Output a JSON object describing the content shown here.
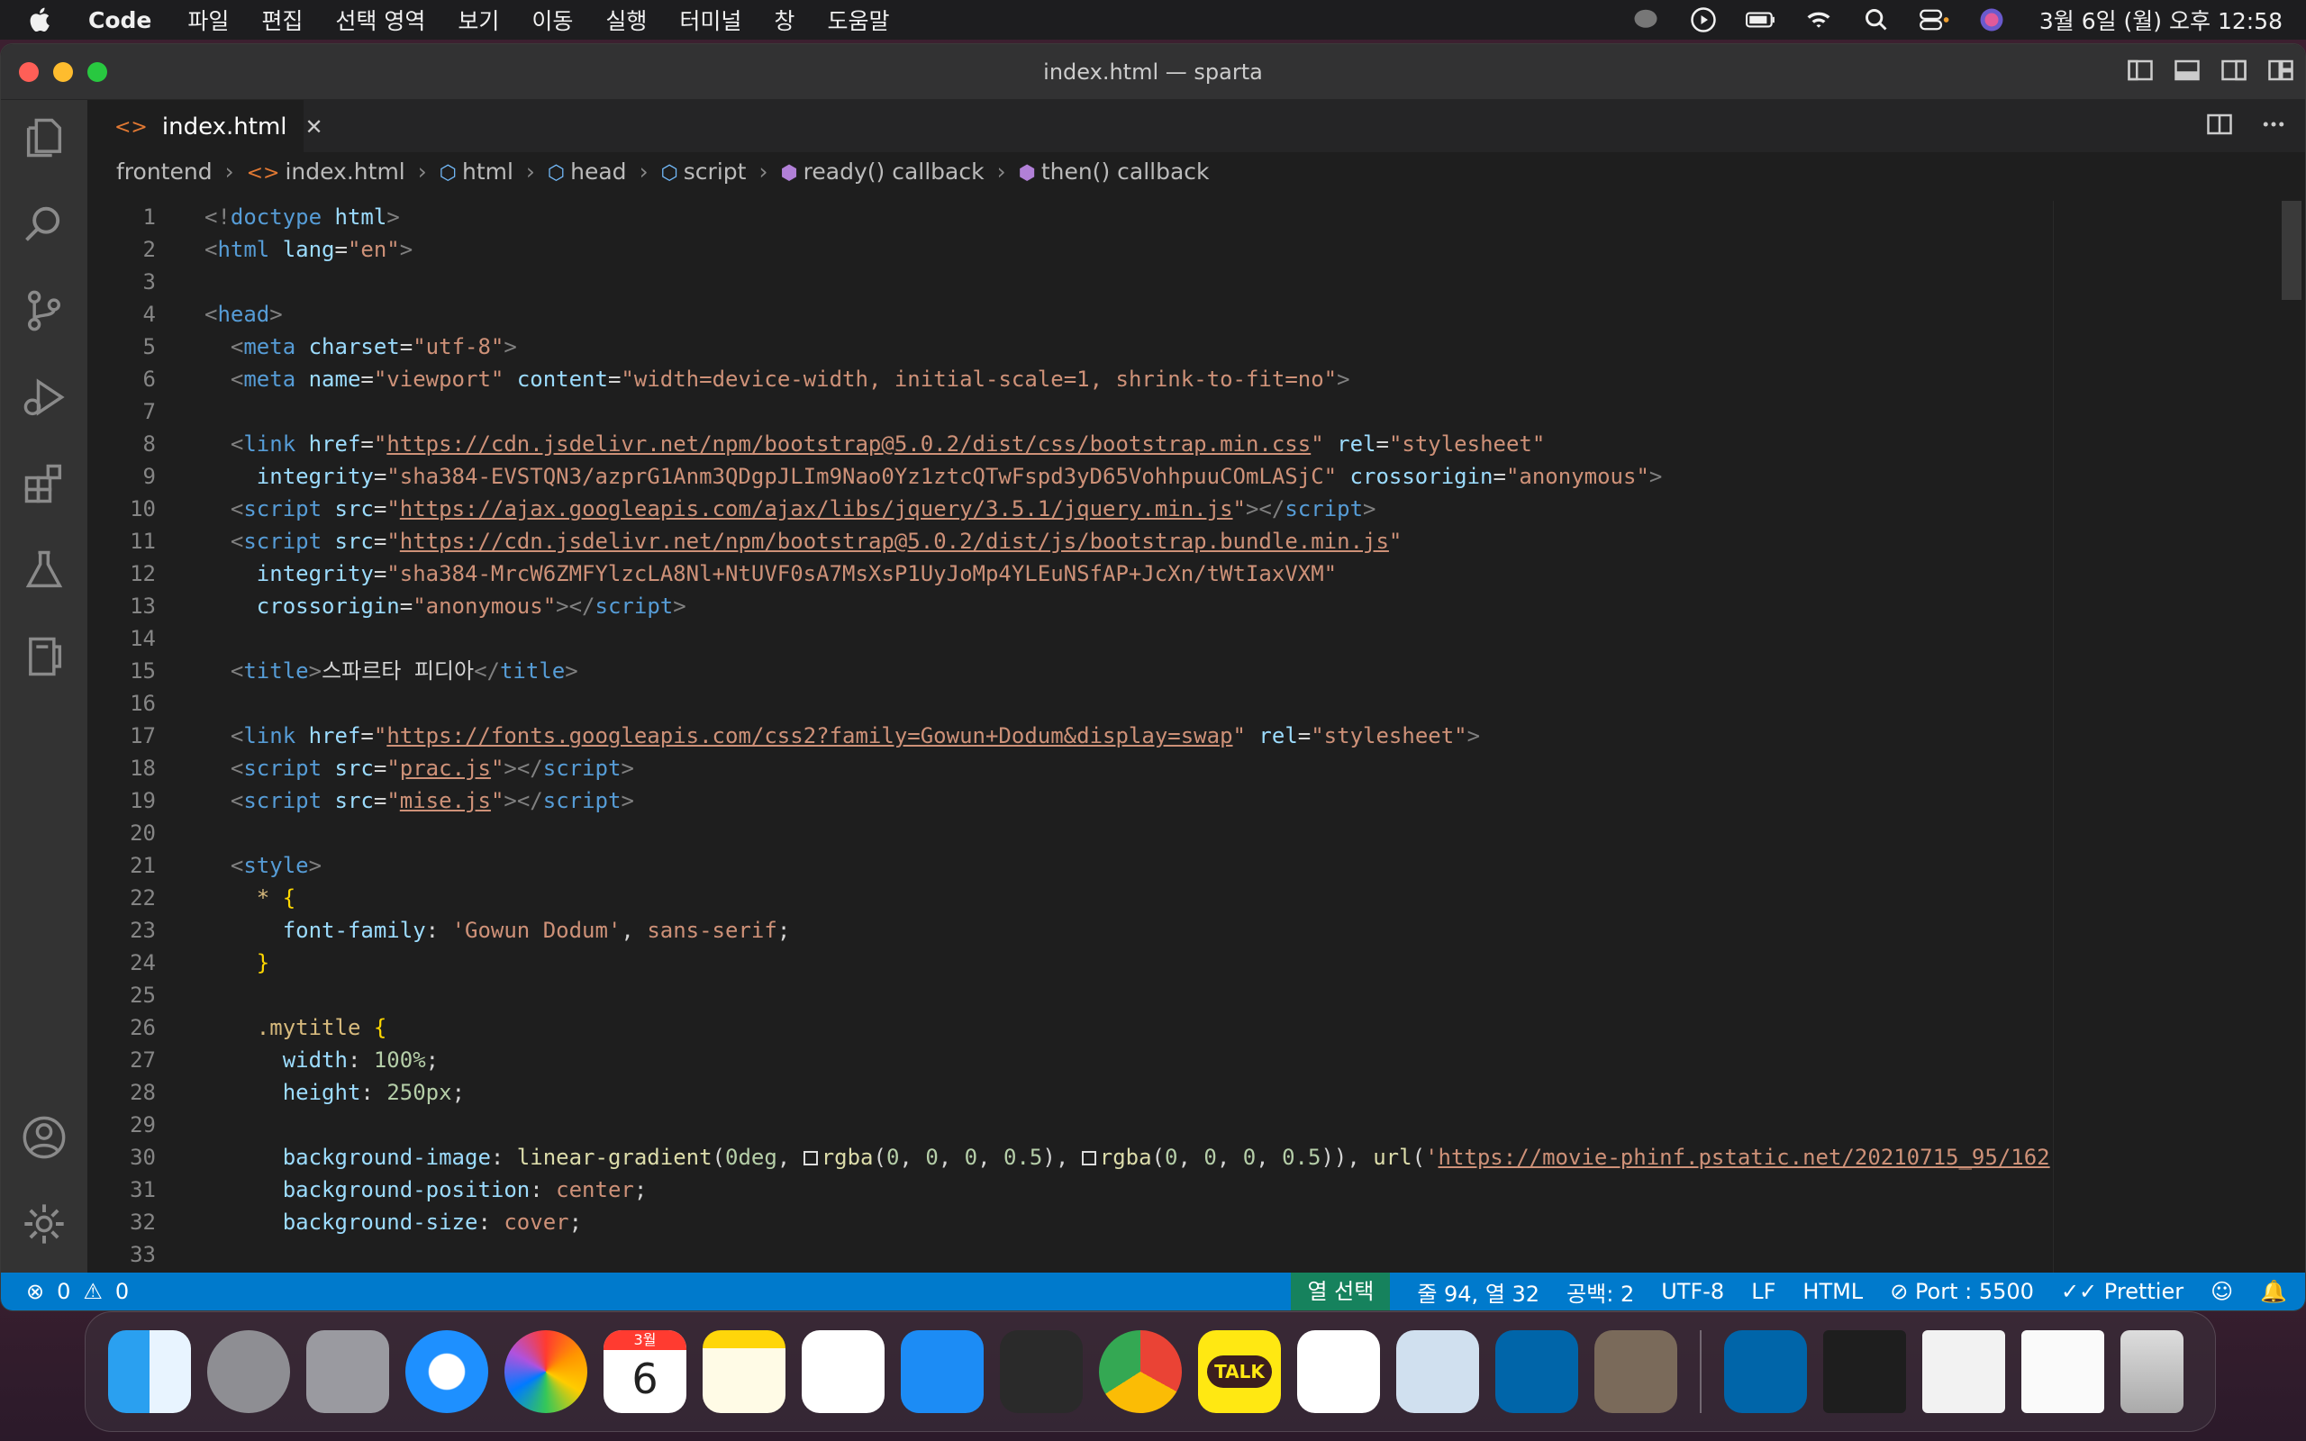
{
  "menubar": {
    "app_name": "Code",
    "items": [
      "파일",
      "편집",
      "선택 영역",
      "보기",
      "이동",
      "실행",
      "터미널",
      "창",
      "도움말"
    ],
    "clock": "3월 6일 (월) 오후 12:58"
  },
  "window": {
    "title": "index.html — sparta"
  },
  "tab": {
    "label": "index.html"
  },
  "breadcrumb": {
    "items": [
      "frontend",
      "index.html",
      "html",
      "head",
      "script",
      "ready() callback",
      "then() callback"
    ]
  },
  "code": {
    "line_numbers": [
      "1",
      "2",
      "3",
      "4",
      "5",
      "6",
      "7",
      "8",
      "9",
      "10",
      "11",
      "12",
      "13",
      "14",
      "15",
      "16",
      "17",
      "18",
      "19",
      "20",
      "21",
      "22",
      "23",
      "24",
      "25",
      "26",
      "27",
      "28",
      "29",
      "30",
      "31",
      "32",
      "33"
    ],
    "strings": {
      "doctype": "html",
      "lang_attr": "lang",
      "lang_val": "\"en\"",
      "meta_charset_val": "\"utf-8\"",
      "viewport_name": "\"viewport\"",
      "viewport_content": "\"width=device-width, initial-scale=1, shrink-to-fit=no\"",
      "bootstrap_css": "https://cdn.jsdelivr.net/npm/bootstrap@5.0.2/dist/css/bootstrap.min.css",
      "stylesheet": "\"stylesheet\"",
      "integrity_css": "\"sha384-EVSTQN3/azprG1Anm3QDgpJLIm9Nao0Yz1ztcQTwFspd3yD65VohhpuuCOmLASjC\"",
      "anonymous": "\"anonymous\"",
      "jquery": "https://ajax.googleapis.com/ajax/libs/jquery/3.5.1/jquery.min.js",
      "bootstrap_js": "https://cdn.jsdelivr.net/npm/bootstrap@5.0.2/dist/js/bootstrap.bundle.min.js",
      "integrity_js": "\"sha384-MrcW6ZMFYlzcLA8Nl+NtUVF0sA7MsXsP1UyJoMp4YLEuNSfAP+JcXn/tWtIaxVXM\"",
      "title_text": "스파르타 피디아",
      "font_url": "https://fonts.googleapis.com/css2?family=Gowun+Dodum&display=swap",
      "prac": "prac.js",
      "mise": "mise.js",
      "font_family_val": "'Gowun Dodum'",
      "sans_serif": "sans-serif",
      "mytitle": ".mytitle",
      "width_val": "100%",
      "height_val": "250px",
      "bg_url": "https://movie-phinf.pstatic.net/20210715_95/162",
      "center": "center",
      "cover": "cover"
    }
  },
  "statusbar": {
    "errors": "0",
    "warnings": "0",
    "selection_mode": "열 선택",
    "position": "줄 94, 열 32",
    "spaces": "공백: 2",
    "encoding": "UTF-8",
    "eol": "LF",
    "language": "HTML",
    "port": "Port : 5500",
    "formatter": "Prettier"
  },
  "dock": {
    "calendar_month": "3월",
    "calendar_day": "6",
    "kakao_label": "TALK"
  },
  "colors": {
    "statusbar": "#007acc",
    "selection_mode_bg": "#16825d",
    "tag": "#569cd6",
    "attribute": "#9cdcfe",
    "string": "#ce9178"
  }
}
